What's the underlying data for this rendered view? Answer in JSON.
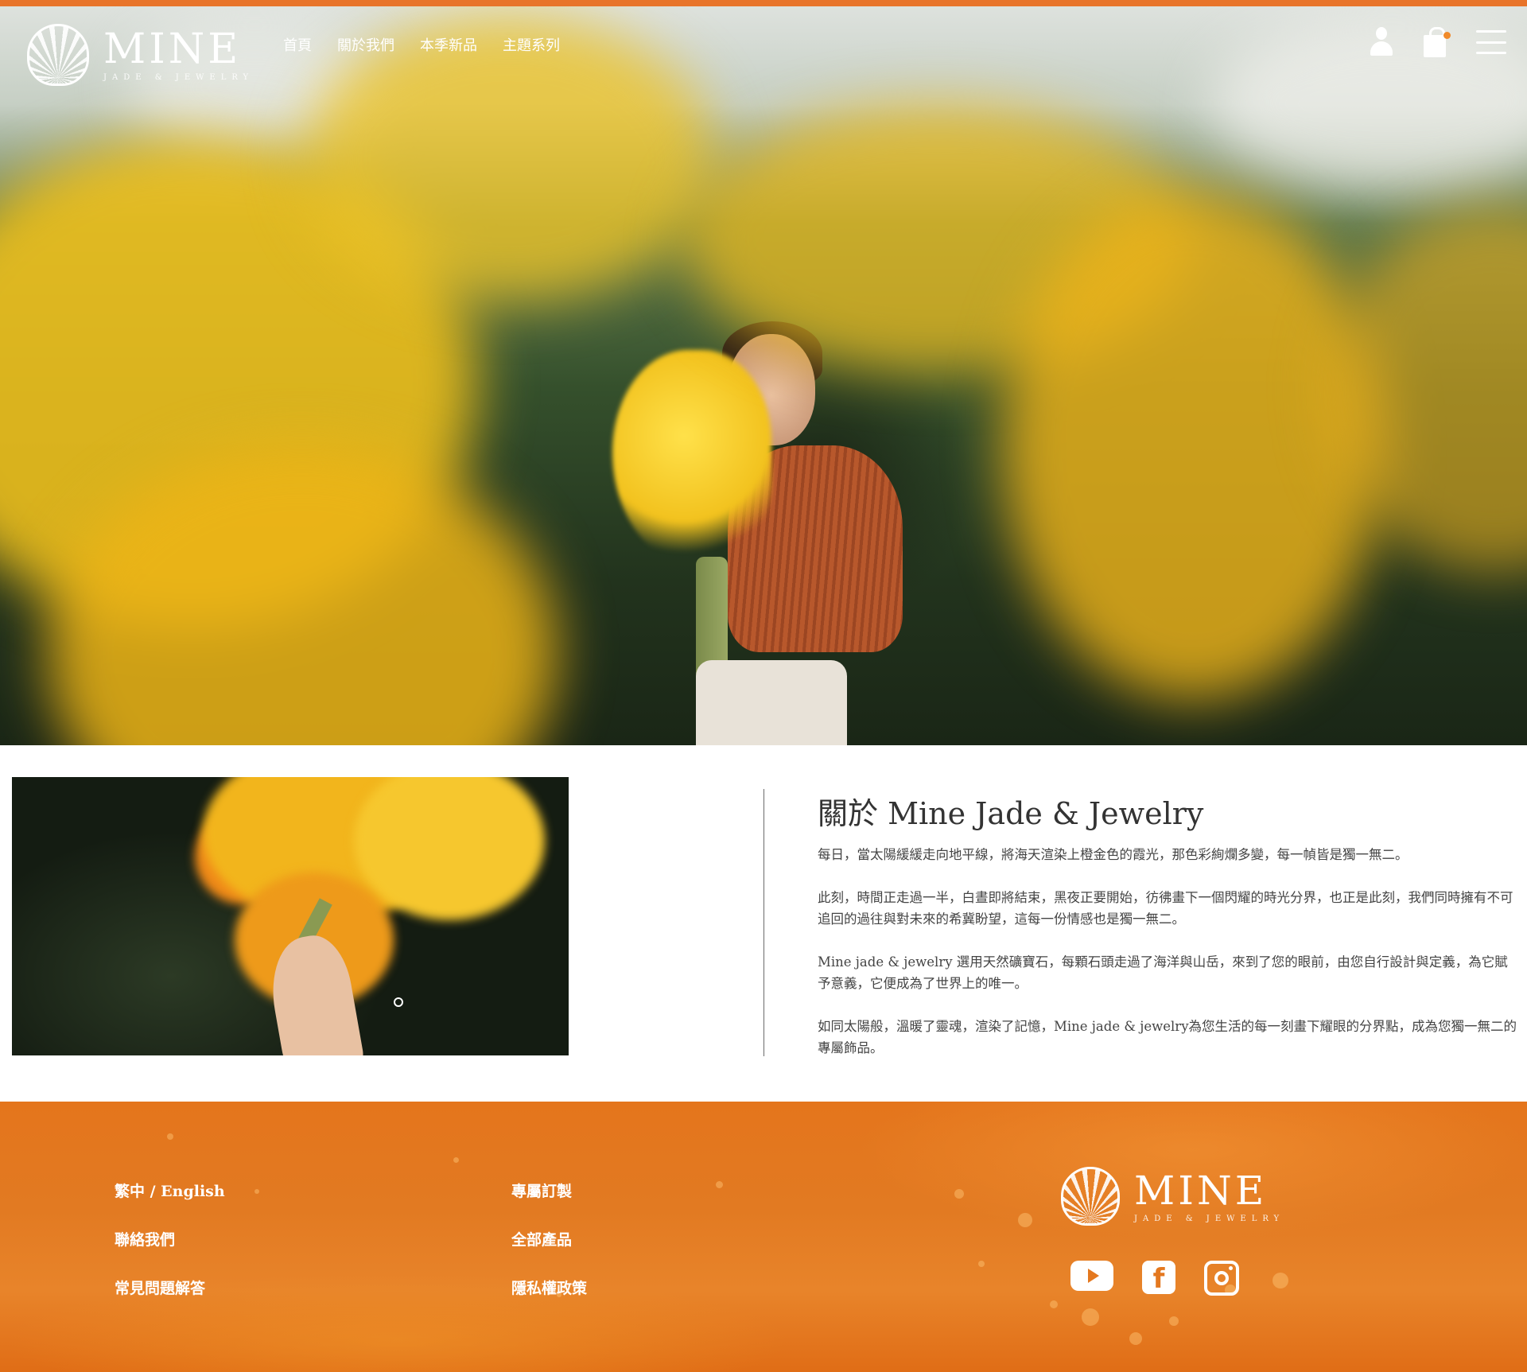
{
  "header": {
    "brand": {
      "name": "MINE",
      "tagline": "JADE & JEWELRY"
    },
    "nav": [
      "首頁",
      "關於我們",
      "本季新品",
      "主題系列"
    ],
    "icons": [
      "user-icon",
      "shopping-bag-icon",
      "menu-icon"
    ]
  },
  "about": {
    "title": "關於 Mine Jade & Jewelry",
    "paragraphs": [
      "每日，當太陽緩緩走向地平線，將海天渲染上橙金色的霞光，那色彩絢爛多變，每一幀皆是獨一無二。",
      "此刻，時間正走過一半，白晝即將結束，黑夜正要開始，彷彿畫下一個閃耀的時光分界，也正是此刻，我們同時擁有不可追回的過往與對未來的希冀盼望，這每一份情感也是獨一無二。",
      "Mine jade & jewelry 選用天然礦寶石，每顆石頭走過了海洋與山岳，來到了您的眼前，由您自行設計與定義，為它賦予意義，它便成為了世界上的唯一。",
      "如同太陽般，溫暖了靈魂，渲染了記憶，Mine jade & jewelry為您生活的每一刻畫下耀眼的分界點，成為您獨一無二的專屬飾品。"
    ]
  },
  "footer": {
    "col1": [
      "繁中 / English",
      "聯絡我們",
      "常見問題解答"
    ],
    "col2": [
      "專屬訂製",
      "全部產品",
      "隱私權政策"
    ],
    "brand": {
      "name": "MINE",
      "tagline": "JADE & JEWELRY"
    },
    "socials": [
      "youtube-icon",
      "facebook-icon",
      "instagram-icon"
    ]
  },
  "colors": {
    "accent": "#e8742a",
    "footer_bg": "#e4781f",
    "text": "#3a3a3a"
  }
}
